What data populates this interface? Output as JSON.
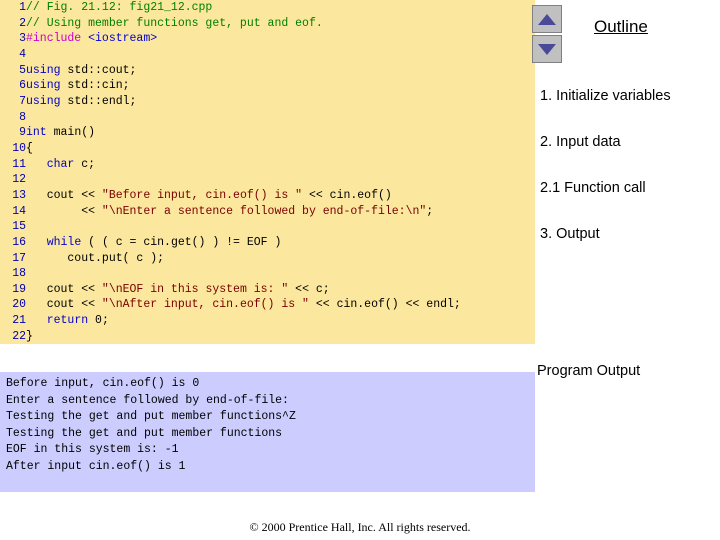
{
  "code_panel": {
    "lines": [
      {
        "num": "1",
        "segments": [
          {
            "t": "// Fig. 21.12: fig21_12.cpp",
            "c": "cmt"
          }
        ]
      },
      {
        "num": "2",
        "segments": [
          {
            "t": "// Using member functions get, put and eof.",
            "c": "cmt"
          }
        ]
      },
      {
        "num": "3",
        "segments": [
          {
            "t": "#include ",
            "c": "pre"
          },
          {
            "t": "<iostream>",
            "c": "kw"
          }
        ]
      },
      {
        "num": "4",
        "segments": [
          {
            "t": "",
            "c": "plain"
          }
        ]
      },
      {
        "num": "5",
        "segments": [
          {
            "t": "using",
            "c": "kw"
          },
          {
            "t": " std::cout;",
            "c": "plain"
          }
        ]
      },
      {
        "num": "6",
        "segments": [
          {
            "t": "using",
            "c": "kw"
          },
          {
            "t": " std::cin;",
            "c": "plain"
          }
        ]
      },
      {
        "num": "7",
        "segments": [
          {
            "t": "using",
            "c": "kw"
          },
          {
            "t": " std::endl;",
            "c": "plain"
          }
        ]
      },
      {
        "num": "8",
        "segments": [
          {
            "t": "",
            "c": "plain"
          }
        ]
      },
      {
        "num": "9",
        "segments": [
          {
            "t": "int",
            "c": "kw"
          },
          {
            "t": " main()",
            "c": "plain"
          }
        ]
      },
      {
        "num": "10",
        "segments": [
          {
            "t": "{",
            "c": "plain"
          }
        ]
      },
      {
        "num": "11",
        "segments": [
          {
            "t": "   ",
            "c": "plain"
          },
          {
            "t": "char",
            "c": "kw"
          },
          {
            "t": " c;",
            "c": "plain"
          }
        ]
      },
      {
        "num": "12",
        "segments": [
          {
            "t": "",
            "c": "plain"
          }
        ]
      },
      {
        "num": "13",
        "segments": [
          {
            "t": "   cout << ",
            "c": "plain"
          },
          {
            "t": "\"Before input, cin.eof() is \"",
            "c": "str"
          },
          {
            "t": " << cin.eof()",
            "c": "plain"
          }
        ]
      },
      {
        "num": "14",
        "segments": [
          {
            "t": "        << ",
            "c": "plain"
          },
          {
            "t": "\"\\nEnter a sentence followed by end-of-file:\\n\"",
            "c": "str"
          },
          {
            "t": ";",
            "c": "plain"
          }
        ]
      },
      {
        "num": "15",
        "segments": [
          {
            "t": "",
            "c": "plain"
          }
        ]
      },
      {
        "num": "16",
        "segments": [
          {
            "t": "   ",
            "c": "plain"
          },
          {
            "t": "while",
            "c": "kw"
          },
          {
            "t": " ( ( c = cin.get() ) != EOF )",
            "c": "plain"
          }
        ]
      },
      {
        "num": "17",
        "segments": [
          {
            "t": "      cout.put( c );",
            "c": "plain"
          }
        ]
      },
      {
        "num": "18",
        "segments": [
          {
            "t": "",
            "c": "plain"
          }
        ]
      },
      {
        "num": "19",
        "segments": [
          {
            "t": "   cout << ",
            "c": "plain"
          },
          {
            "t": "\"\\nEOF in this system is: \"",
            "c": "str"
          },
          {
            "t": " << c;",
            "c": "plain"
          }
        ]
      },
      {
        "num": "20",
        "segments": [
          {
            "t": "   cout << ",
            "c": "plain"
          },
          {
            "t": "\"\\nAfter input, cin.eof() is \"",
            "c": "str"
          },
          {
            "t": " << cin.eof() << endl;",
            "c": "plain"
          }
        ]
      },
      {
        "num": "21",
        "segments": [
          {
            "t": "   ",
            "c": "plain"
          },
          {
            "t": "return",
            "c": "kw"
          },
          {
            "t": " 0;",
            "c": "plain"
          }
        ]
      },
      {
        "num": "22",
        "segments": [
          {
            "t": "}",
            "c": "plain"
          }
        ]
      }
    ]
  },
  "output_panel": {
    "text": "Before input, cin.eof() is 0\nEnter a sentence followed by end-of-file:\nTesting the get and put member functions^Z\nTesting the get and put member functions\nEOF in this system is: -1\nAfter input cin.eof() is 1"
  },
  "outline": {
    "title": "Outline",
    "items": [
      {
        "label": "1. Initialize variables"
      },
      {
        "label": "2. Input data"
      },
      {
        "label": "2.1 Function call"
      },
      {
        "label": "3. Output"
      }
    ],
    "program_output_label": "Program Output"
  },
  "scroll": {
    "up_icon": "triangle-up-icon",
    "down_icon": "triangle-down-icon"
  },
  "footer": {
    "text": "© 2000 Prentice Hall, Inc. All rights reserved."
  }
}
